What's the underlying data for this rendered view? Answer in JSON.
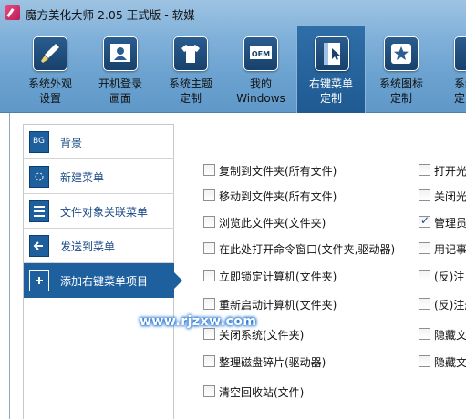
{
  "window": {
    "title": "魔方美化大师 2.05 正式版 - 软媒"
  },
  "toolbar": {
    "items": [
      {
        "label": "系统外观\n设置",
        "icon": "brush-icon"
      },
      {
        "label": "开机登录\n画面",
        "icon": "user-screen-icon"
      },
      {
        "label": "系统主题\n定制",
        "icon": "tshirt-icon"
      },
      {
        "label": "我的\nWindows",
        "icon": "oem-icon"
      },
      {
        "label": "右键菜单\n定制",
        "icon": "context-menu-icon",
        "active": true
      },
      {
        "label": "系统图标\n定制",
        "icon": "star-icon"
      },
      {
        "label": "系统\n定",
        "icon": "partial-icon"
      }
    ],
    "oem_text": "OEM"
  },
  "sidebar": {
    "items": [
      {
        "label": "背景",
        "icon": "bg-icon",
        "icon_text": "BG"
      },
      {
        "label": "新建菜单",
        "icon": "new-menu-icon"
      },
      {
        "label": "文件对象关联菜单",
        "icon": "file-assoc-icon"
      },
      {
        "label": "发送到菜单",
        "icon": "send-to-icon"
      },
      {
        "label": "添加右键菜单项目",
        "icon": "add-item-icon",
        "active": true
      }
    ]
  },
  "options_left": [
    {
      "label": "复制到文件夹(所有文件)",
      "checked": false
    },
    {
      "label": "移动到文件夹(所有文件)",
      "checked": false
    },
    {
      "label": "浏览此文件夹(文件夹)",
      "checked": false
    },
    {
      "label": "在此处打开命令窗口(文件夹,驱动器)",
      "checked": false
    },
    {
      "label": "立即锁定计算机(文件夹)",
      "checked": false
    },
    {
      "label": "重新启动计算机(文件夹)",
      "checked": false
    },
    {
      "label": "关闭系统(文件夹)",
      "checked": false
    },
    {
      "label": "整理磁盘碎片(驱动器)",
      "checked": false
    },
    {
      "label": "清空回收站(文件)",
      "checked": false
    }
  ],
  "options_right": [
    {
      "label": "打开光",
      "checked": false
    },
    {
      "label": "关闭光",
      "checked": false
    },
    {
      "label": "管理员",
      "checked": true
    },
    {
      "label": "用记事",
      "checked": false
    },
    {
      "label": "(反)注",
      "checked": false
    },
    {
      "label": "(反)注册",
      "checked": false
    },
    {
      "label": "隐藏文",
      "checked": false
    },
    {
      "label": "隐藏文",
      "checked": false
    }
  ],
  "watermark": "www.rjzxw.com",
  "colors": {
    "accent": "#1e5f9e",
    "toolbar_gradient_top": "#9ec3e2",
    "toolbar_gradient_bottom": "#5f98c9",
    "nav_text": "#1a4a86"
  }
}
